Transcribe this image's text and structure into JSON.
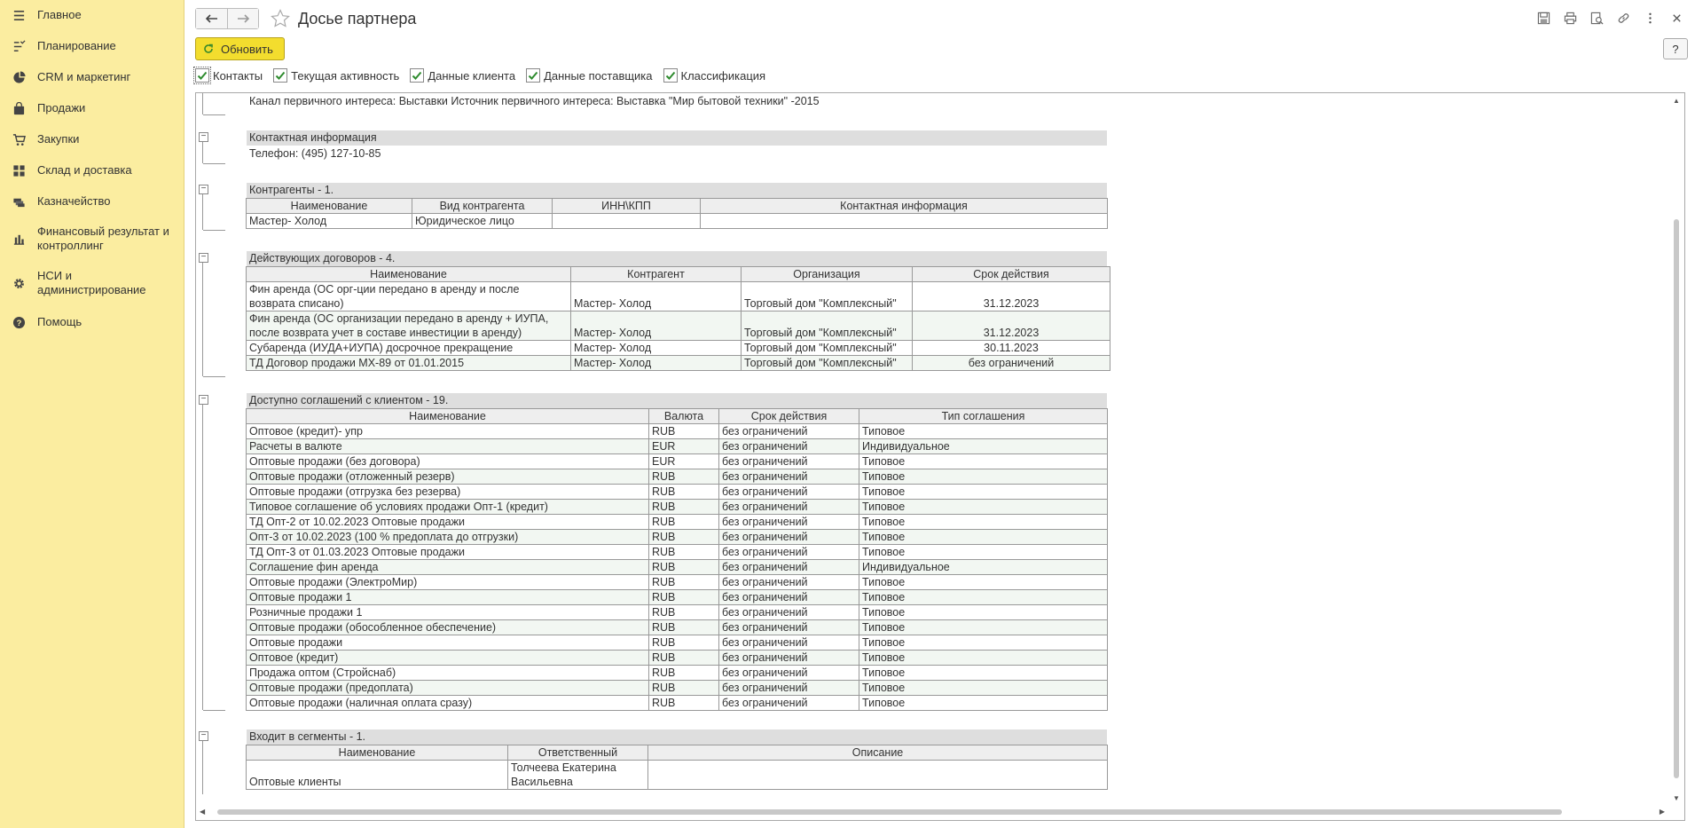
{
  "sidebar": {
    "items": [
      {
        "label": "Главное",
        "icon": "menu-icon"
      },
      {
        "label": "Планирование",
        "icon": "planning-icon"
      },
      {
        "label": "CRM и маркетинг",
        "icon": "pie-chart-icon"
      },
      {
        "label": "Продажи",
        "icon": "bag-icon"
      },
      {
        "label": "Закупки",
        "icon": "cart-icon"
      },
      {
        "label": "Склад и доставка",
        "icon": "grid-icon"
      },
      {
        "label": "Казначейство",
        "icon": "treasury-icon"
      },
      {
        "label": "Финансовый результат и контроллинг",
        "icon": "bar-chart-icon"
      },
      {
        "label": "НСИ и администрирование",
        "icon": "gear-icon"
      },
      {
        "label": "Помощь",
        "icon": "help-icon"
      }
    ]
  },
  "header": {
    "title": "Досье партнера",
    "refresh_label": "Обновить",
    "help_label": "?"
  },
  "filters": [
    {
      "label": "Контакты",
      "checked": true
    },
    {
      "label": "Текущая активность",
      "checked": true
    },
    {
      "label": "Данные клиента",
      "checked": true
    },
    {
      "label": "Данные поставщика",
      "checked": true
    },
    {
      "label": "Классификация",
      "checked": true
    }
  ],
  "report": {
    "interest_line": "Канал первичного интереса: Выставки  Источник первичного интереса: Выставка \"Мир бытовой техники\" -2015",
    "contact": {
      "header": "Контактная информация",
      "phone": "Телефон: (495) 127-10-85"
    },
    "counterparties": {
      "header": "Контрагенты - 1.",
      "columns": [
        "Наименование",
        "Вид контрагента",
        "ИНН\\КПП",
        "Контактная информация"
      ],
      "rows": [
        [
          "Мастер- Холод",
          "Юридическое лицо",
          "",
          ""
        ]
      ]
    },
    "contracts": {
      "header": "Действующих договоров - 4.",
      "columns": [
        "Наименование",
        "Контрагент",
        "Организация",
        "Срок действия"
      ],
      "rows": [
        [
          "Фин аренда (ОС орг-ции передано в аренду  и после возврата списано)",
          "Мастер- Холод",
          "Торговый дом \"Комплексный\"",
          "31.12.2023"
        ],
        [
          "Фин аренда (ОС организации передано в аренду + ИУПА, после возврата учет в составе инвестиции в аренду)",
          "Мастер- Холод",
          "Торговый дом \"Комплексный\"",
          "31.12.2023"
        ],
        [
          "Субаренда (ИУДА+ИУПА) досрочное прекращение",
          "Мастер- Холод",
          "Торговый дом \"Комплексный\"",
          "30.11.2023"
        ],
        [
          "ТД Договор продажи МХ-89 от 01.01.2015",
          "Мастер- Холод",
          "Торговый дом \"Комплексный\"",
          "без ограничений"
        ]
      ]
    },
    "agreements": {
      "header": "Доступно соглашений с клиентом - 19.",
      "columns": [
        "Наименование",
        "Валюта",
        "Срок действия",
        "Тип соглашения"
      ],
      "rows": [
        [
          "Оптовое (кредит)- упр",
          "RUB",
          "без ограничений",
          "Типовое"
        ],
        [
          "Расчеты в валюте",
          "EUR",
          "без ограничений",
          "Индивидуальное"
        ],
        [
          "Оптовые продажи (без договора)",
          "EUR",
          "без ограничений",
          "Типовое"
        ],
        [
          "Оптовые продажи (отложенный резерв)",
          "RUB",
          "без ограничений",
          "Типовое"
        ],
        [
          "Оптовые продажи (отгрузка без резерва)",
          "RUB",
          "без ограничений",
          "Типовое"
        ],
        [
          "Типовое соглашение об условиях продажи Опт-1 (кредит)",
          "RUB",
          "без ограничений",
          "Типовое"
        ],
        [
          "ТД Опт-2 от 10.02.2023 Оптовые продажи",
          "RUB",
          "без ограничений",
          "Типовое"
        ],
        [
          "Опт-3 от 10.02.2023 (100 % предоплата до отгрузки)",
          "RUB",
          "без ограничений",
          "Типовое"
        ],
        [
          "ТД Опт-3 от 01.03.2023 Оптовые продажи",
          "RUB",
          "без ограничений",
          "Типовое"
        ],
        [
          "Соглашение  фин аренда",
          "RUB",
          "без ограничений",
          "Индивидуальное"
        ],
        [
          "Оптовые продажи (ЭлектроМир)",
          "RUB",
          "без ограничений",
          "Типовое"
        ],
        [
          "Оптовые продажи 1",
          "RUB",
          "без ограничений",
          "Типовое"
        ],
        [
          "Розничные  продажи 1",
          "RUB",
          "без ограничений",
          "Типовое"
        ],
        [
          "Оптовые продажи (обособленное обеспечение)",
          "RUB",
          "без ограничений",
          "Типовое"
        ],
        [
          "Оптовые продажи",
          "RUB",
          "без ограничений",
          "Типовое"
        ],
        [
          "Оптовое (кредит)",
          "RUB",
          "без ограничений",
          "Типовое"
        ],
        [
          "Продажа оптом (Стройснаб)",
          "RUB",
          "без ограничений",
          "Типовое"
        ],
        [
          "Оптовые продажи (предоплата)",
          "RUB",
          "без ограничений",
          "Типовое"
        ],
        [
          "Оптовые продажи (наличная оплата сразу)",
          "RUB",
          "без ограничений",
          "Типовое"
        ]
      ]
    },
    "segments": {
      "header": "Входит в сегменты - 1.",
      "columns": [
        "Наименование",
        "Ответственный",
        "Описание"
      ],
      "rows": [
        [
          "Оптовые клиенты",
          "Толчеева Екатерина Васильевна",
          ""
        ]
      ]
    }
  }
}
